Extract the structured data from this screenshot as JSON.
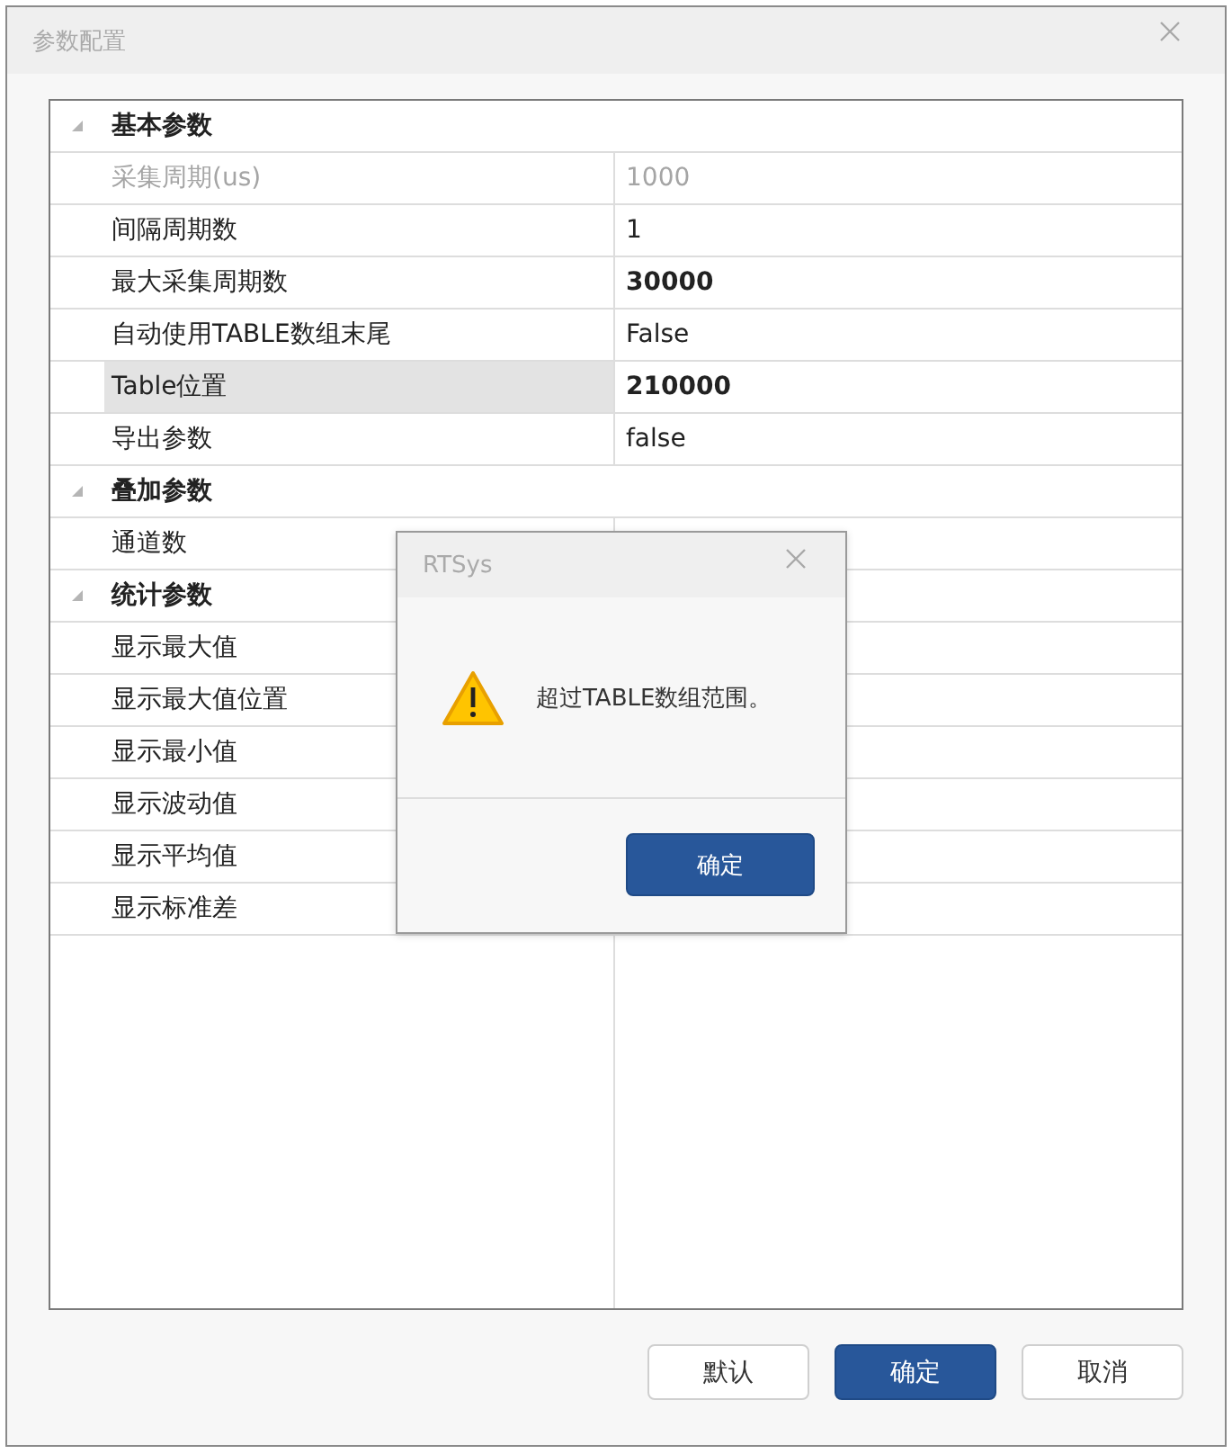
{
  "window": {
    "title": "参数配置"
  },
  "groups": [
    {
      "label": "基本参数",
      "expanded": true,
      "items": [
        {
          "name": "采集周期(us)",
          "value": "1000",
          "disabled": true,
          "modified": false,
          "selected": false
        },
        {
          "name": "间隔周期数",
          "value": "1",
          "disabled": false,
          "modified": false,
          "selected": false
        },
        {
          "name": "最大采集周期数",
          "value": "30000",
          "disabled": false,
          "modified": true,
          "selected": false
        },
        {
          "name": "自动使用TABLE数组末尾",
          "value": "False",
          "disabled": false,
          "modified": false,
          "selected": false
        },
        {
          "name": "Table位置",
          "value": "210000",
          "disabled": false,
          "modified": true,
          "selected": true
        },
        {
          "name": "导出参数",
          "value": "false",
          "disabled": false,
          "modified": false,
          "selected": false
        }
      ]
    },
    {
      "label": "叠加参数",
      "expanded": true,
      "items": [
        {
          "name": "通道数",
          "disabled": false,
          "selected": false
        }
      ]
    },
    {
      "label": "统计参数",
      "expanded": true,
      "items": [
        {
          "name": "显示最大值",
          "disabled": false,
          "selected": false
        },
        {
          "name": "显示最大值位置",
          "disabled": false,
          "selected": false
        },
        {
          "name": "显示最小值",
          "disabled": false,
          "selected": false
        },
        {
          "name": "显示波动值",
          "disabled": false,
          "selected": false
        },
        {
          "name": "显示平均值",
          "disabled": false,
          "selected": false
        },
        {
          "name": "显示标准差",
          "disabled": false,
          "selected": false
        }
      ]
    }
  ],
  "buttons": [
    {
      "label": "默认",
      "kind": "default"
    },
    {
      "label": "确定",
      "kind": "primary"
    },
    {
      "label": "取消",
      "kind": "default"
    }
  ],
  "dialog": {
    "title": "RTSys",
    "message": "超过TABLE数组范围。",
    "buttons": [
      {
        "label": "确定",
        "kind": "primary"
      }
    ]
  }
}
